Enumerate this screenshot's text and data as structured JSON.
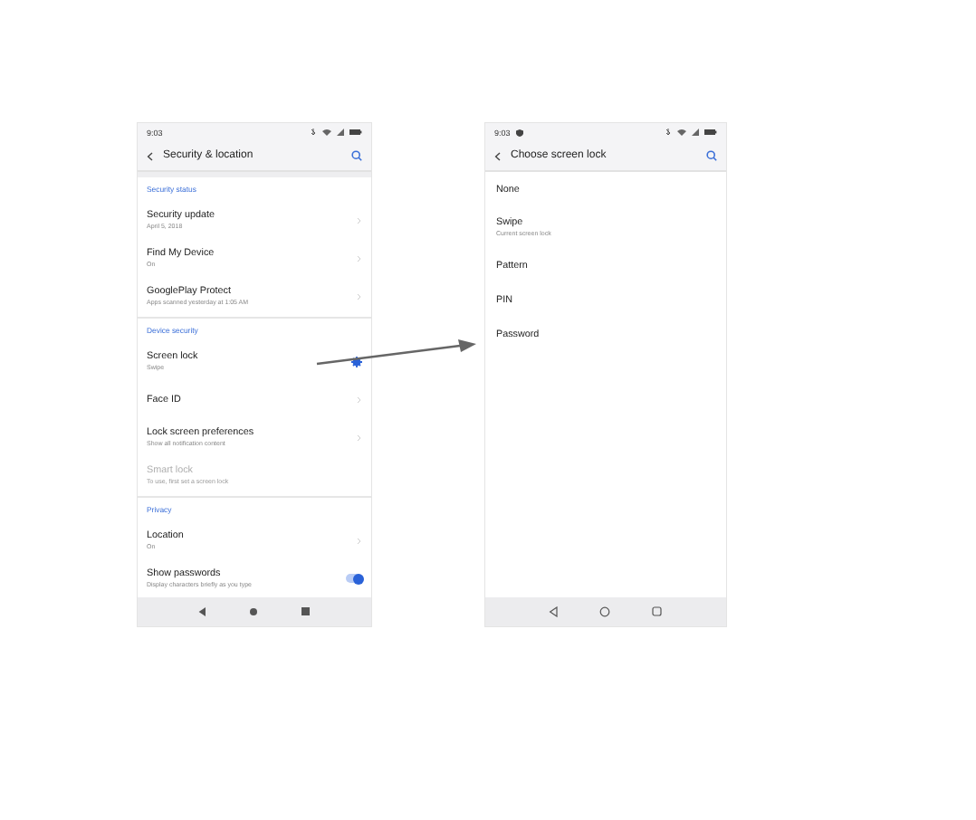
{
  "left_screen": {
    "status_bar": {
      "time": "9:03",
      "shield": false
    },
    "title": "Security & location",
    "sections": [
      {
        "header": "Security status",
        "items": [
          {
            "title": "Security update",
            "subtitle": "April 5, 2018",
            "kind": "chevron",
            "disabled": false
          },
          {
            "title": "Find My Device",
            "subtitle": "On",
            "kind": "chevron",
            "disabled": false
          },
          {
            "title": "GooglePlay Protect",
            "subtitle": "Apps scanned yesterday at 1:05 AM",
            "kind": "chevron",
            "disabled": false
          }
        ]
      },
      {
        "header": "Device security",
        "items": [
          {
            "title": "Screen lock",
            "subtitle": "Swipe",
            "kind": "gear",
            "disabled": false
          },
          {
            "title": "Face ID",
            "kind": "chevron",
            "disabled": false
          },
          {
            "title": "Lock screen preferences",
            "subtitle": "Show all notification content",
            "kind": "chevron",
            "disabled": false
          },
          {
            "title": "Smart lock",
            "subtitle": "To use, first set a screen lock",
            "kind": "plain",
            "disabled": true
          }
        ]
      },
      {
        "header": "Privacy",
        "items": [
          {
            "title": "Location",
            "subtitle": "On",
            "kind": "chevron",
            "disabled": false
          },
          {
            "title": "Show passwords",
            "subtitle": "Display characters briefly as you type",
            "kind": "toggle",
            "on": true,
            "disabled": false
          }
        ]
      }
    ],
    "nav_bar": {
      "kind": "filled"
    }
  },
  "right_screen": {
    "status_bar": {
      "time": "9:03",
      "shield": true
    },
    "title": "Choose screen lock",
    "options": [
      {
        "title": "None"
      },
      {
        "title": "Swipe",
        "subtitle": "Current screen lock"
      },
      {
        "title": "Pattern"
      },
      {
        "title": "PIN"
      },
      {
        "title": "Password"
      }
    ],
    "nav_bar": {
      "kind": "outline"
    }
  }
}
